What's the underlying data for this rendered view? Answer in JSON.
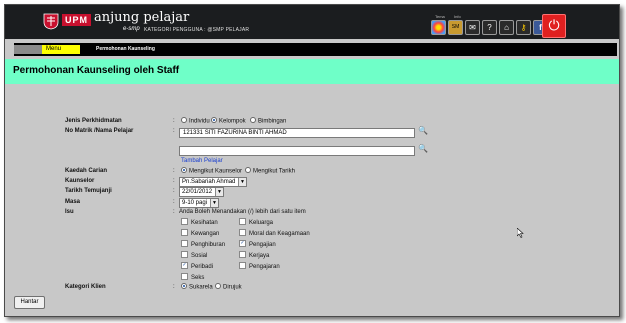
{
  "header": {
    "brand": "UPM",
    "app_name": "anjung pelajar",
    "app_sub": "e-smp",
    "kategori": "KATEGORI PENGGUNA : @SMP PELAJAR",
    "tool_labels": [
      "Tema",
      "Info"
    ],
    "tool_icons": [
      "theme-wheel-icon",
      "sm-icon",
      "chat-icon",
      "help-icon",
      "home-icon",
      "key-icon",
      "facebook-icon"
    ]
  },
  "menubar": {
    "menu_label": "Menu",
    "breadcrumb": "Permohonan Kaunseling"
  },
  "page_title": "Permohonan Kaunseling oleh Staff",
  "form": {
    "jenis": {
      "label": "Jenis Perkhidmatan",
      "options": [
        "Individu",
        "Kelompok",
        "Bimbingan"
      ],
      "selected": "Kelompok"
    },
    "matrik": {
      "label": "No Matrik /Nama Pelajar",
      "value1": "121331 SITI FAZURINA BINTI AHMAD",
      "value2": "",
      "add_link": "Tambah Pelajar"
    },
    "kaedah": {
      "label": "Kaedah Carian",
      "options": [
        "Mengikut Kaunselor",
        "Mengikut Tarikh"
      ],
      "selected": "Mengikut Kaunselor"
    },
    "kaunselor": {
      "label": "Kaunselor",
      "value": "Pn.Sabariah Ahmad"
    },
    "tarikh": {
      "label": "Tarikh Temujanji",
      "value": "22/01/2012"
    },
    "masa": {
      "label": "Masa",
      "value": "9-10 pagi"
    },
    "isu": {
      "label": "Isu",
      "note": "Anda Boleh Menandakan (/) lebih dari satu item",
      "items": [
        {
          "label": "Kesihatan",
          "checked": false
        },
        {
          "label": "Keluarga",
          "checked": false
        },
        {
          "label": "Kewangan",
          "checked": false
        },
        {
          "label": "Moral dan Keagamaan",
          "checked": false
        },
        {
          "label": "Penghiburan",
          "checked": false
        },
        {
          "label": "Pengajian",
          "checked": true
        },
        {
          "label": "Sosial",
          "checked": false
        },
        {
          "label": "Kerjaya",
          "checked": false
        },
        {
          "label": "Peribadi",
          "checked": true
        },
        {
          "label": "Pengajaran",
          "checked": false
        },
        {
          "label": "Seks",
          "checked": false
        }
      ]
    },
    "kategori_klien": {
      "label": "Kategori Klien",
      "options": [
        "Sukarela",
        "Dirujuk"
      ],
      "selected": "Sukarela"
    }
  },
  "submit_label": "Hantar",
  "colors": {
    "header_bg": "#1b1d1f",
    "title_bg": "#6fffc8",
    "menu_btn": "#ffff00",
    "power": "#e02020",
    "link": "#1a3fd0"
  }
}
